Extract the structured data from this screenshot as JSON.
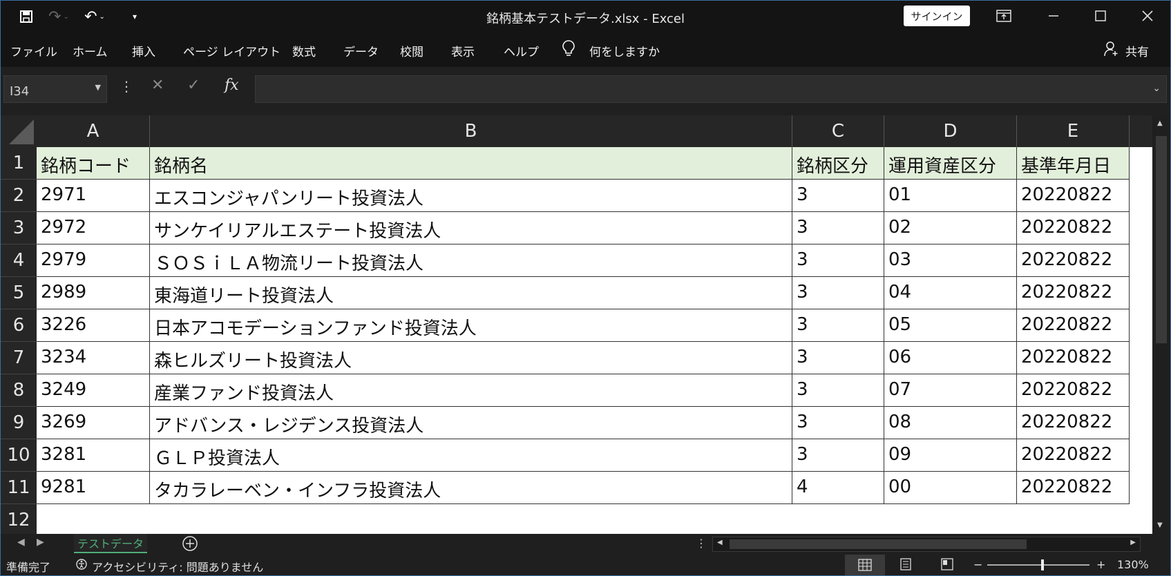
{
  "window": {
    "title": "銘柄基本テストデータ.xlsx  -  Excel",
    "signin_label": "サインイン"
  },
  "menu": {
    "items": [
      "ファイル",
      "ホーム",
      "挿入",
      "ページ レイアウト",
      "数式",
      "データ",
      "校閲",
      "表示",
      "ヘルプ"
    ],
    "search_label": "何をしますか",
    "share_label": "共有"
  },
  "formula_bar": {
    "name_box": "I34",
    "formula": "",
    "fx_label": "fx"
  },
  "sheet": {
    "columns": [
      "A",
      "B",
      "C",
      "D",
      "E"
    ],
    "row_numbers": [
      "1",
      "2",
      "3",
      "4",
      "5",
      "6",
      "7",
      "8",
      "9",
      "10",
      "11",
      "12"
    ],
    "rows": [
      [
        "銘柄コード",
        "銘柄名",
        "銘柄区分",
        "運用資産区分",
        "基準年月日"
      ],
      [
        "2971",
        "エスコンジャパンリート投資法人",
        "3",
        "01",
        "20220822"
      ],
      [
        "2972",
        "サンケイリアルエステート投資法人",
        "3",
        "02",
        "20220822"
      ],
      [
        "2979",
        "ＳＯＳｉＬＡ物流リート投資法人",
        "3",
        "03",
        "20220822"
      ],
      [
        "2989",
        "東海道リート投資法人",
        "3",
        "04",
        "20220822"
      ],
      [
        "3226",
        "日本アコモデーションファンド投資法人",
        "3",
        "05",
        "20220822"
      ],
      [
        "3234",
        "森ヒルズリート投資法人",
        "3",
        "06",
        "20220822"
      ],
      [
        "3249",
        "産業ファンド投資法人",
        "3",
        "07",
        "20220822"
      ],
      [
        "3269",
        "アドバンス・レジデンス投資法人",
        "3",
        "08",
        "20220822"
      ],
      [
        "3281",
        "ＧＬＰ投資法人",
        "3",
        "09",
        "20220822"
      ],
      [
        "9281",
        "タカラレーベン・インフラ投資法人",
        "4",
        "00",
        "20220822"
      ]
    ],
    "header_fill": "#e2efda"
  },
  "tabs": {
    "active": "テストデータ"
  },
  "status": {
    "ready": "準備完了",
    "accessibility": "アクセシビリティ: 問題ありません",
    "zoom": "130%"
  },
  "colors": {
    "accent": "#4fb07a",
    "chrome_bg": "#141414"
  }
}
